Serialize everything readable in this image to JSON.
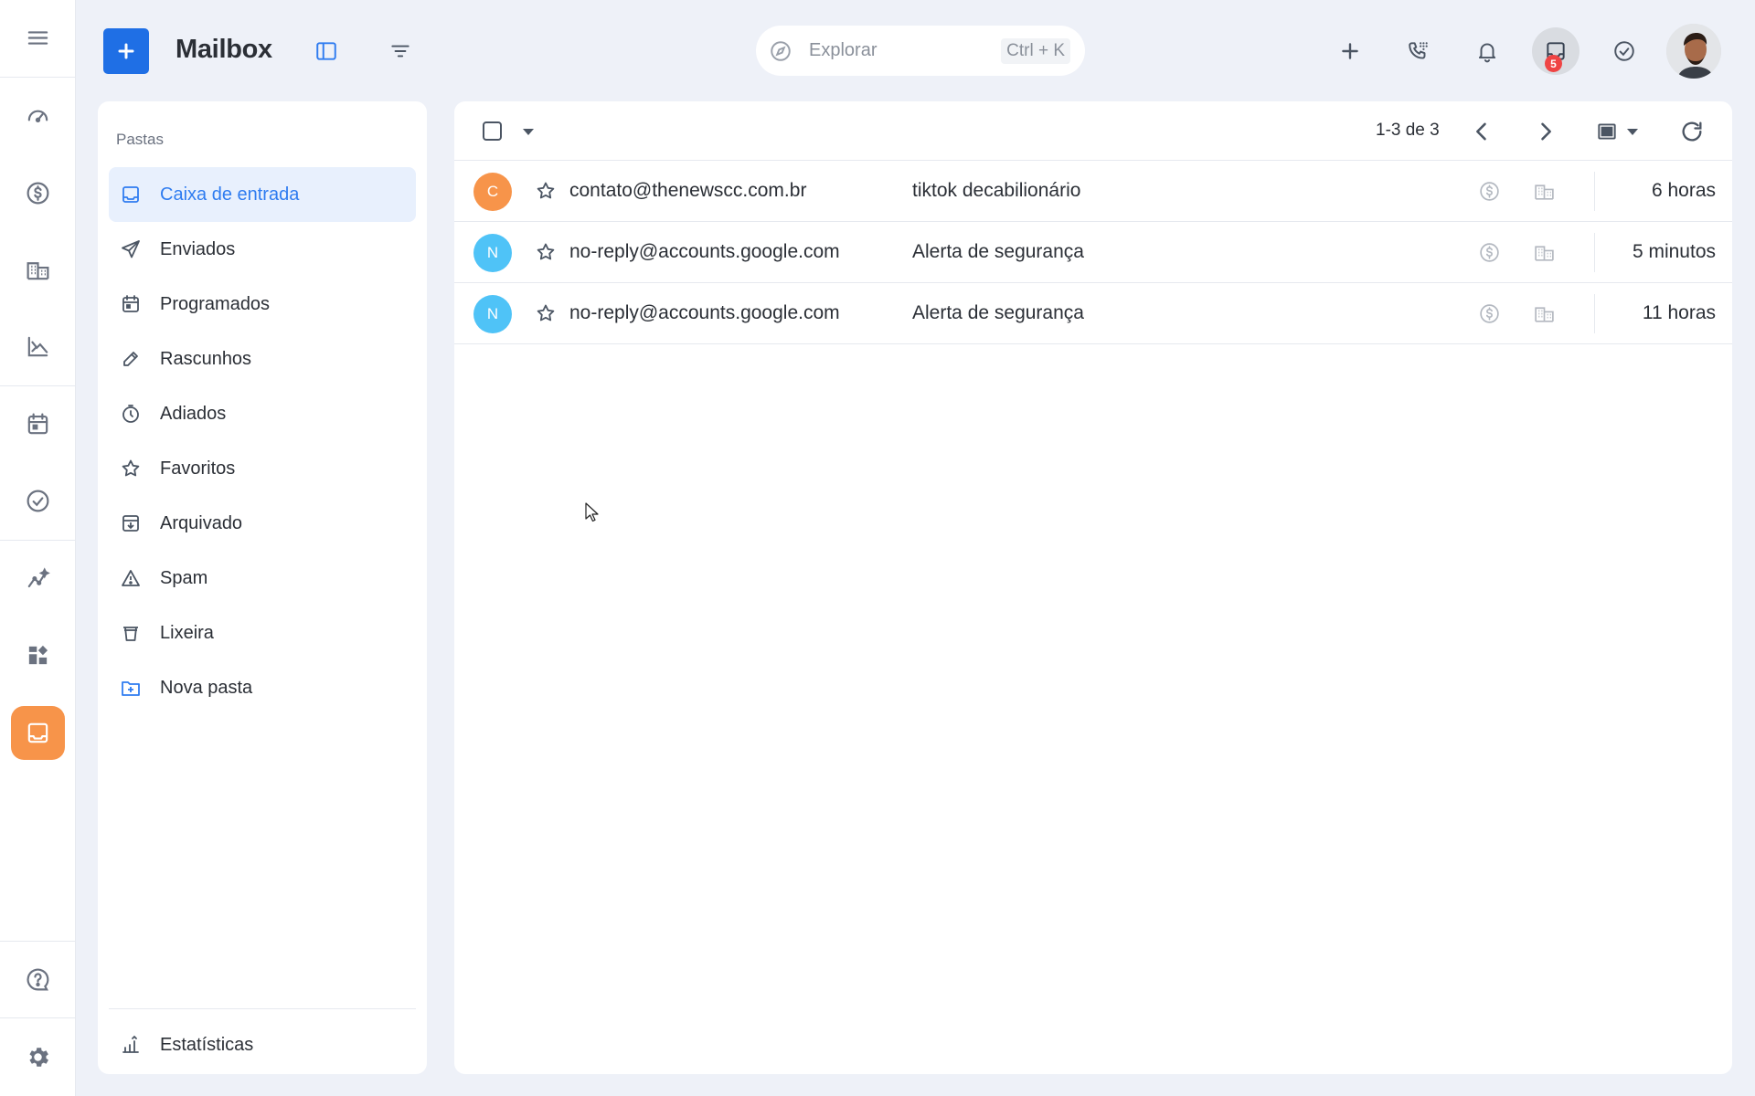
{
  "app": {
    "title": "Mailbox"
  },
  "colors": {
    "accent": "#1f6fe5",
    "active_rail": "#f7944a",
    "active_folder_bg": "#e8f0fd",
    "badge": "#ef4444"
  },
  "rail": {
    "items": [
      {
        "name": "menu-icon"
      },
      {
        "name": "dashboard-icon"
      },
      {
        "name": "dollar-icon"
      },
      {
        "name": "building-icon"
      },
      {
        "name": "chart-icon"
      },
      {
        "name": "calendar-icon"
      },
      {
        "name": "check-circle-icon"
      },
      {
        "name": "sparkline-icon"
      },
      {
        "name": "widgets-icon"
      },
      {
        "name": "inbox-icon",
        "active": true
      },
      {
        "name": "help-icon"
      },
      {
        "name": "settings-icon"
      }
    ]
  },
  "topbar": {
    "search_placeholder": "Explorar",
    "search_shortcut": "Ctrl + K",
    "notification_count": "5"
  },
  "folders": {
    "title": "Pastas",
    "items": [
      {
        "label": "Caixa de entrada",
        "icon": "inbox-icon",
        "active": true
      },
      {
        "label": "Enviados",
        "icon": "send-icon"
      },
      {
        "label": "Programados",
        "icon": "calendar-icon"
      },
      {
        "label": "Rascunhos",
        "icon": "pencil-icon"
      },
      {
        "label": "Adiados",
        "icon": "timer-icon"
      },
      {
        "label": "Favoritos",
        "icon": "star-icon"
      },
      {
        "label": "Arquivado",
        "icon": "archive-icon"
      },
      {
        "label": "Spam",
        "icon": "warning-icon"
      },
      {
        "label": "Lixeira",
        "icon": "trash-icon"
      },
      {
        "label": "Nova pasta",
        "icon": "new-folder-icon"
      }
    ],
    "footer": {
      "label": "Estatísticas",
      "icon": "stats-icon"
    }
  },
  "mail_list": {
    "pager": "1-3 de 3",
    "rows": [
      {
        "initial": "C",
        "avatar_color": "#f7944a",
        "sender": "contato@thenewscc.com.br",
        "subject": "tiktok decabilionário",
        "time": "6 horas"
      },
      {
        "initial": "N",
        "avatar_color": "#4fc3f7",
        "sender": "no-reply@accounts.google.com",
        "subject": "Alerta de segurança",
        "time": "5 minutos"
      },
      {
        "initial": "N",
        "avatar_color": "#4fc3f7",
        "sender": "no-reply@accounts.google.com",
        "subject": "Alerta de segurança",
        "time": "11 horas"
      }
    ]
  }
}
